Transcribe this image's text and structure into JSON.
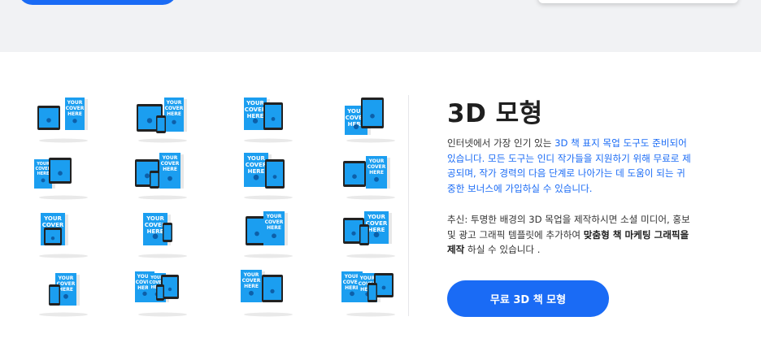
{
  "colors": {
    "accent": "#1a6bf5",
    "top_band": "#f1f2f4",
    "book_blue": "#1b9ef0",
    "device_dark": "#222222"
  },
  "section": {
    "title": "3D 모형",
    "para1_plain": "인터넷에서 가장 인기 있는 ",
    "para1_link": "3D 책 표지 목업 도구도 준비되어 있습니다. 모든 도구는 인디 작가들을 지원하기 위해 무료로 제공되며, 작가 경력의 다음 단계로 나아가는 데 도움이 되는 귀중한 보너스에 가입하실 수 있습니다.",
    "para2_plain1": "추신: 투명한 배경의 3D 목업을 제작하시면 소셜 미디어, 홍보 및 광고 그래픽 템플릿에 추가하여 ",
    "para2_bold": "맞춤형 책 마케팅 그래픽을 제작",
    "para2_plain2": " 하실 수 있습니다 .",
    "cta_label": "무료 3D 책 모형"
  },
  "mockups": {
    "cover_lines": [
      "YOUR",
      "COVER",
      "HERE"
    ],
    "items": [
      {
        "name": "mockup-tablet-phone-book",
        "kind": "tablet-book"
      },
      {
        "name": "mockup-tablet-book-pair",
        "kind": "tablet-book-wide"
      },
      {
        "name": "mockup-book-tablet",
        "kind": "book-tablet"
      },
      {
        "name": "mockup-book-tablet-right",
        "kind": "book-tablet-right"
      },
      {
        "name": "mockup-tablet-book-angle",
        "kind": "tablet-book-angle"
      },
      {
        "name": "mockup-tablet-book-phone",
        "kind": "tablet-book-phone"
      },
      {
        "name": "mockup-book-ereader",
        "kind": "book-ereader"
      },
      {
        "name": "mockup-tablet-book-tall",
        "kind": "tablet-book-tall"
      },
      {
        "name": "mockup-book-tablet-flat",
        "kind": "book-tablet-flat"
      },
      {
        "name": "mockup-book-phone",
        "kind": "book-phone"
      },
      {
        "name": "mockup-tablet-book-side",
        "kind": "tablet-book-side"
      },
      {
        "name": "mockup-device-set",
        "kind": "device-set"
      },
      {
        "name": "mockup-phone-book",
        "kind": "phone-book"
      },
      {
        "name": "mockup-books-devices",
        "kind": "books-devices"
      },
      {
        "name": "mockup-book-tablet-stand",
        "kind": "book-tablet-stand"
      },
      {
        "name": "mockup-full-set",
        "kind": "full-set"
      }
    ]
  }
}
